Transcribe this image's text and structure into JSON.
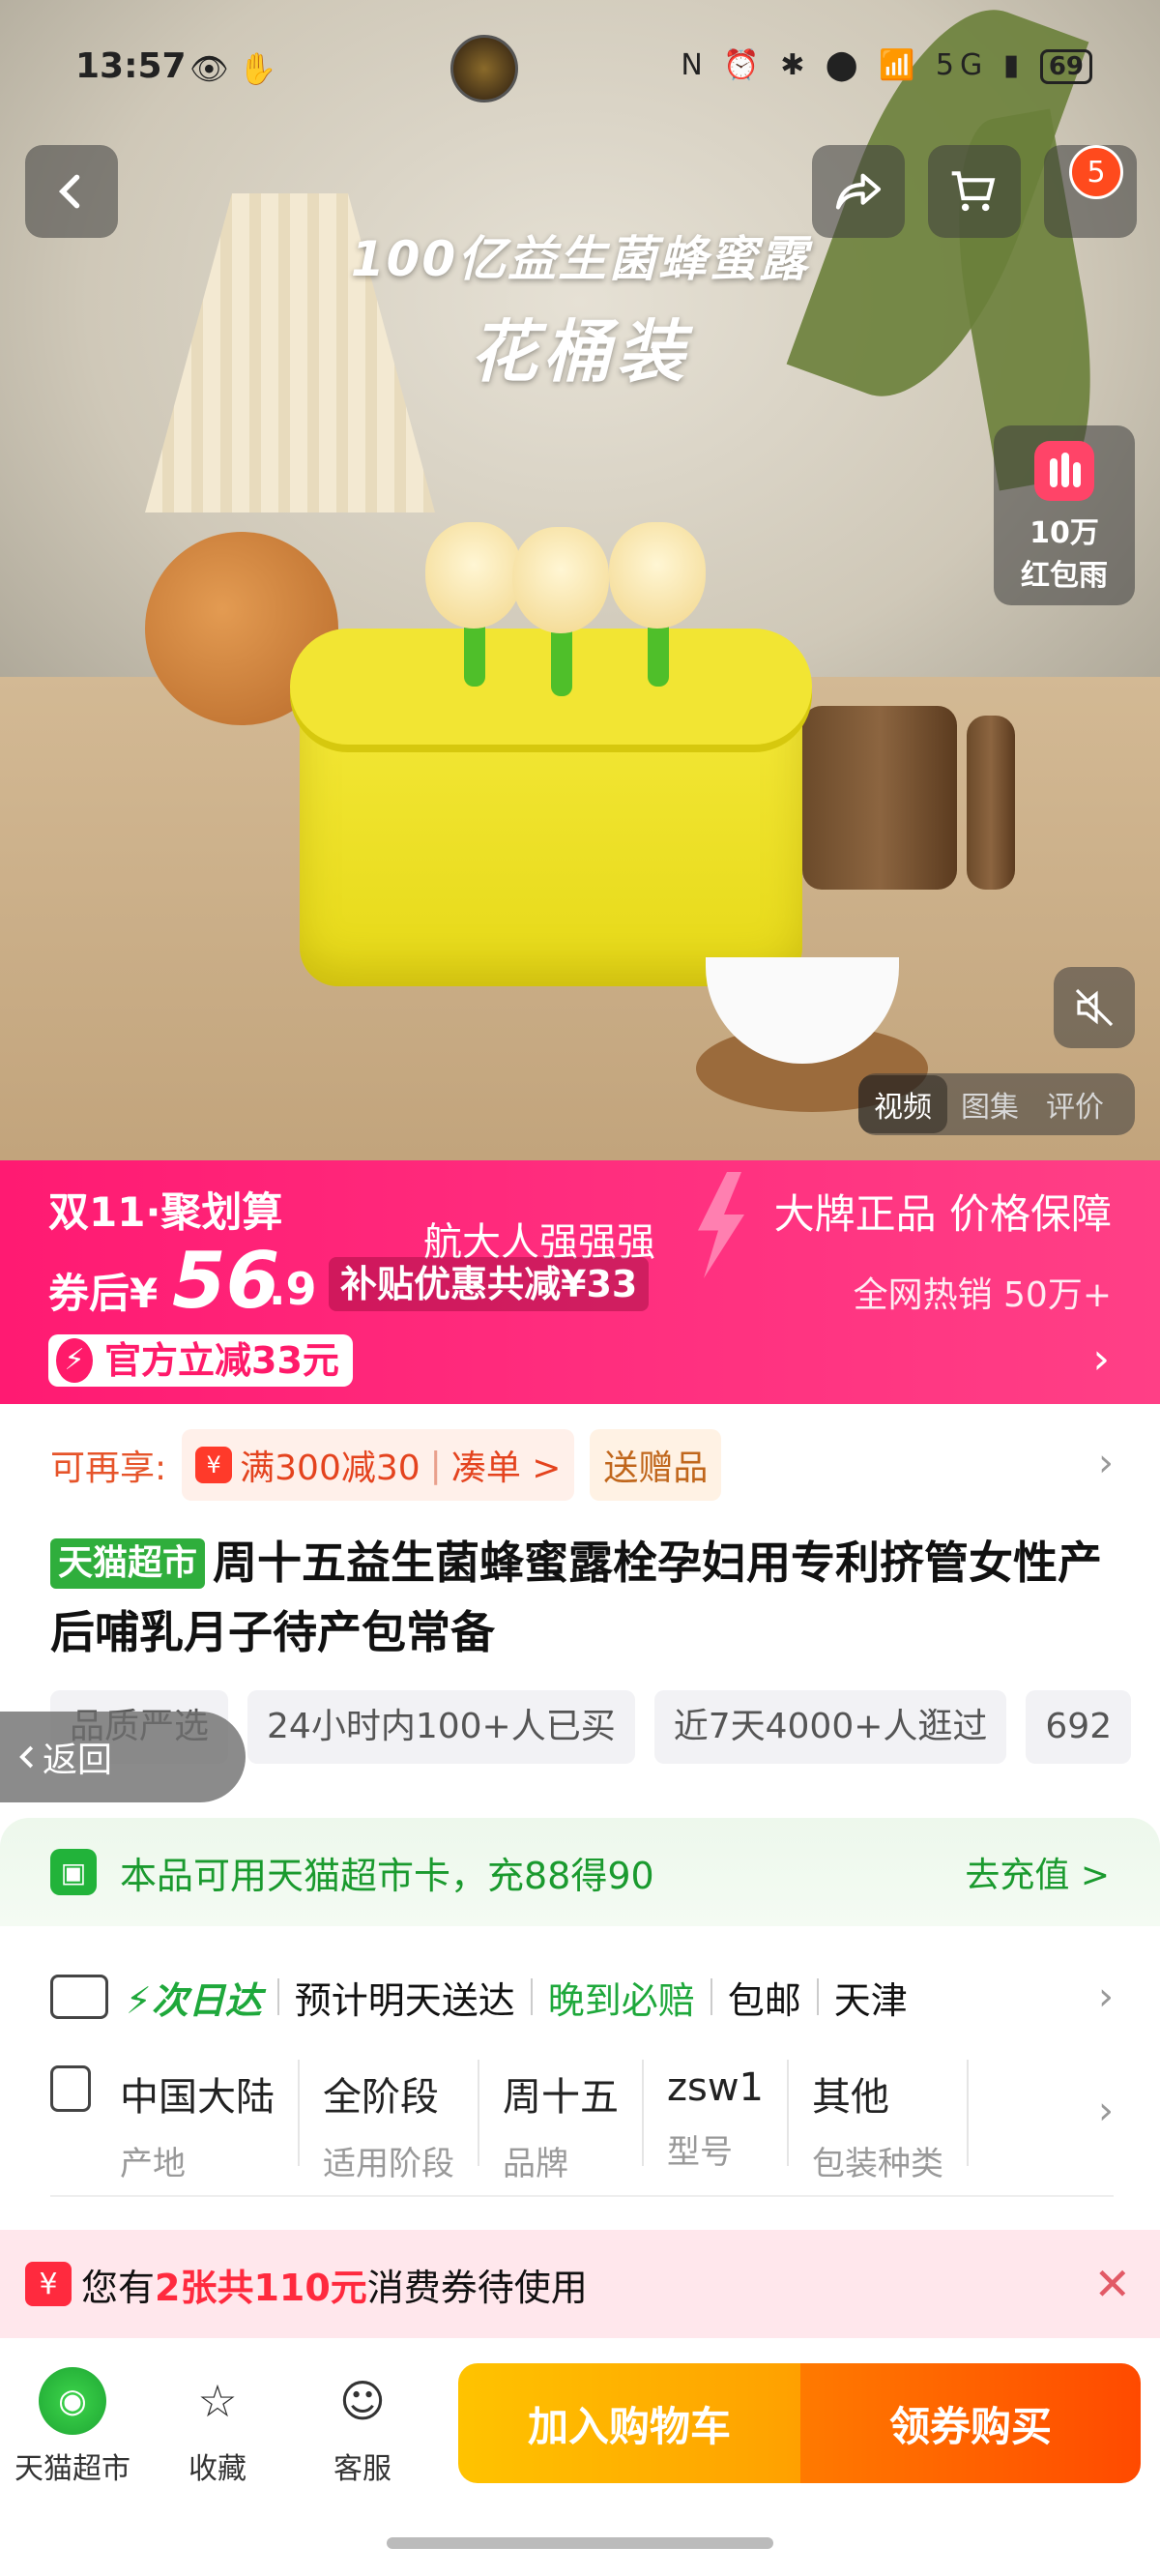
{
  "status_bar": {
    "time": "13:57",
    "battery": "69",
    "left_icons": "👁 ✋",
    "right_icons": "N ⏰ ✱ ⬤ 📶 5G ▮"
  },
  "hero": {
    "title_line1": "100亿益生菌蜂蜜露",
    "title_line2": "花桶装",
    "cart_badge": "5",
    "red_rain_line1": "10万",
    "red_rain_line2": "红包雨",
    "media_tabs": [
      "视频",
      "图集",
      "评价"
    ]
  },
  "promo": {
    "brand": "双11·聚划算",
    "after_coupon": "券后¥",
    "price_int": "56",
    "price_dec": ".9",
    "author": "航大人强强强",
    "subsidy": "补贴优惠共减¥33",
    "official": "官方立减33元",
    "guarantee": "大牌正品 价格保障",
    "hot_sales": "全网热销 50万+"
  },
  "offers": {
    "label": "可再享:",
    "full_reduction": "满300减30",
    "combine": "凑单 >",
    "gift": "送赠品"
  },
  "product": {
    "tag": "天猫超市",
    "title": "周十五益生菌蜂蜜露栓孕妇用专利挤管女性产后哺乳月子待产包常备"
  },
  "pills": [
    "品质严选",
    "24小时内100+人已买",
    "近7天4000+人逛过",
    "692"
  ],
  "back_label": "返回",
  "tmall_card": {
    "text": "本品可用天猫超市卡，充88得90",
    "cta": "去充值 >"
  },
  "shipping": {
    "next_day": "次日达",
    "estimate": "预计明天送达",
    "late_pay": "晚到必赔",
    "free_ship": "包邮",
    "city": "天津"
  },
  "specs": [
    {
      "value": "中国大陆",
      "key": "产地"
    },
    {
      "value": "全阶段",
      "key": "适用阶段"
    },
    {
      "value": "周十五",
      "key": "品牌"
    },
    {
      "value": "zsw1",
      "key": "型号"
    },
    {
      "value": "其他",
      "key": "包装种类"
    }
  ],
  "coupon": {
    "prefix": "您有",
    "highlight": "2张共110元",
    "suffix": "消费券待使用"
  },
  "bottom_bar": {
    "tmall": "天猫超市",
    "favorite": "收藏",
    "service": "客服",
    "add_cart": "加入购物车",
    "buy": "领券购买"
  },
  "colors": {
    "promo_pink": "#ff1a72",
    "tmall_green": "#22b33a",
    "cart_yellow": "#ffb000",
    "buy_orange": "#ff5a00"
  }
}
